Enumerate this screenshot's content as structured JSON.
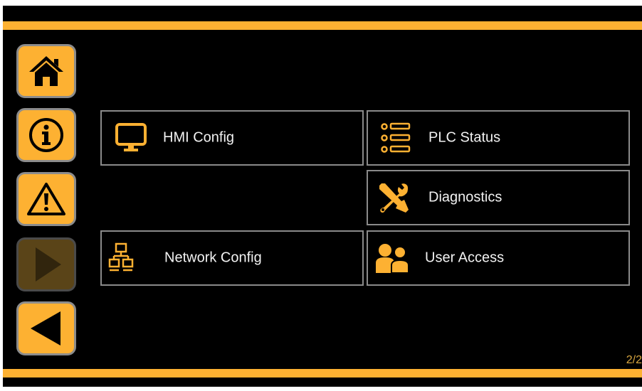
{
  "colors": {
    "accent": "#FDB132",
    "accent_dim": "#5a4418",
    "background": "#000000",
    "border": "#8a8a8a",
    "text": "#f2f2f2",
    "page_indicator": "#d9a740"
  },
  "nav": {
    "items": [
      {
        "icon": "home-icon",
        "enabled": true
      },
      {
        "icon": "info-icon",
        "enabled": true
      },
      {
        "icon": "warning-icon",
        "enabled": true
      },
      {
        "icon": "play-forward-icon",
        "enabled": false
      },
      {
        "icon": "back-icon",
        "enabled": true
      }
    ]
  },
  "tiles": {
    "hmi_config": {
      "label": "HMI Config",
      "icon": "monitor-icon"
    },
    "plc_status": {
      "label": "PLC Status",
      "icon": "list-icon"
    },
    "diagnostics": {
      "label": "Diagnostics",
      "icon": "tools-icon"
    },
    "network_config": {
      "label": "Network Config",
      "icon": "network-icon"
    },
    "user_access": {
      "label": "User Access",
      "icon": "users-icon"
    }
  },
  "page_indicator": "2/2"
}
